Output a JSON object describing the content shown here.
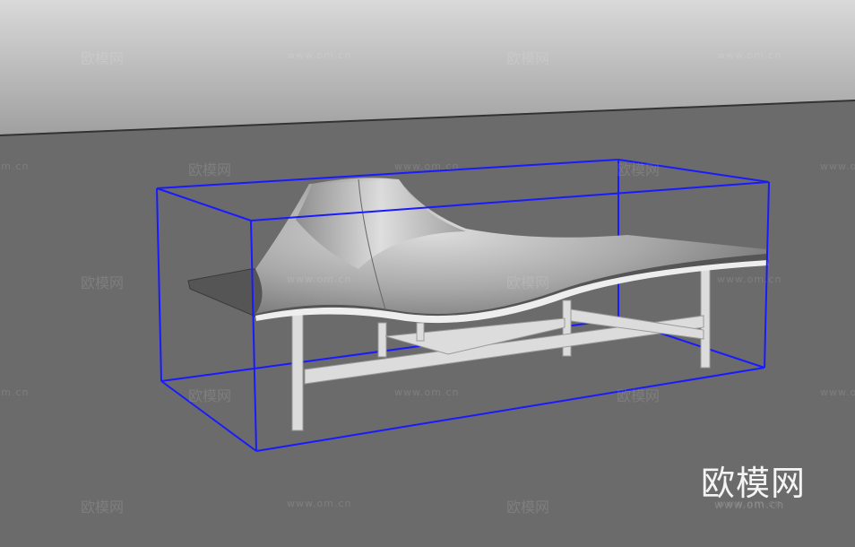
{
  "watermark": {
    "logo": "欧模网",
    "url": "www.om.cn"
  },
  "colors": {
    "bounding_box": "#1a1aff",
    "floor": "#6b6b6b",
    "sky_top": "#d9d9d9",
    "sky_bottom": "#a2a2a2"
  }
}
